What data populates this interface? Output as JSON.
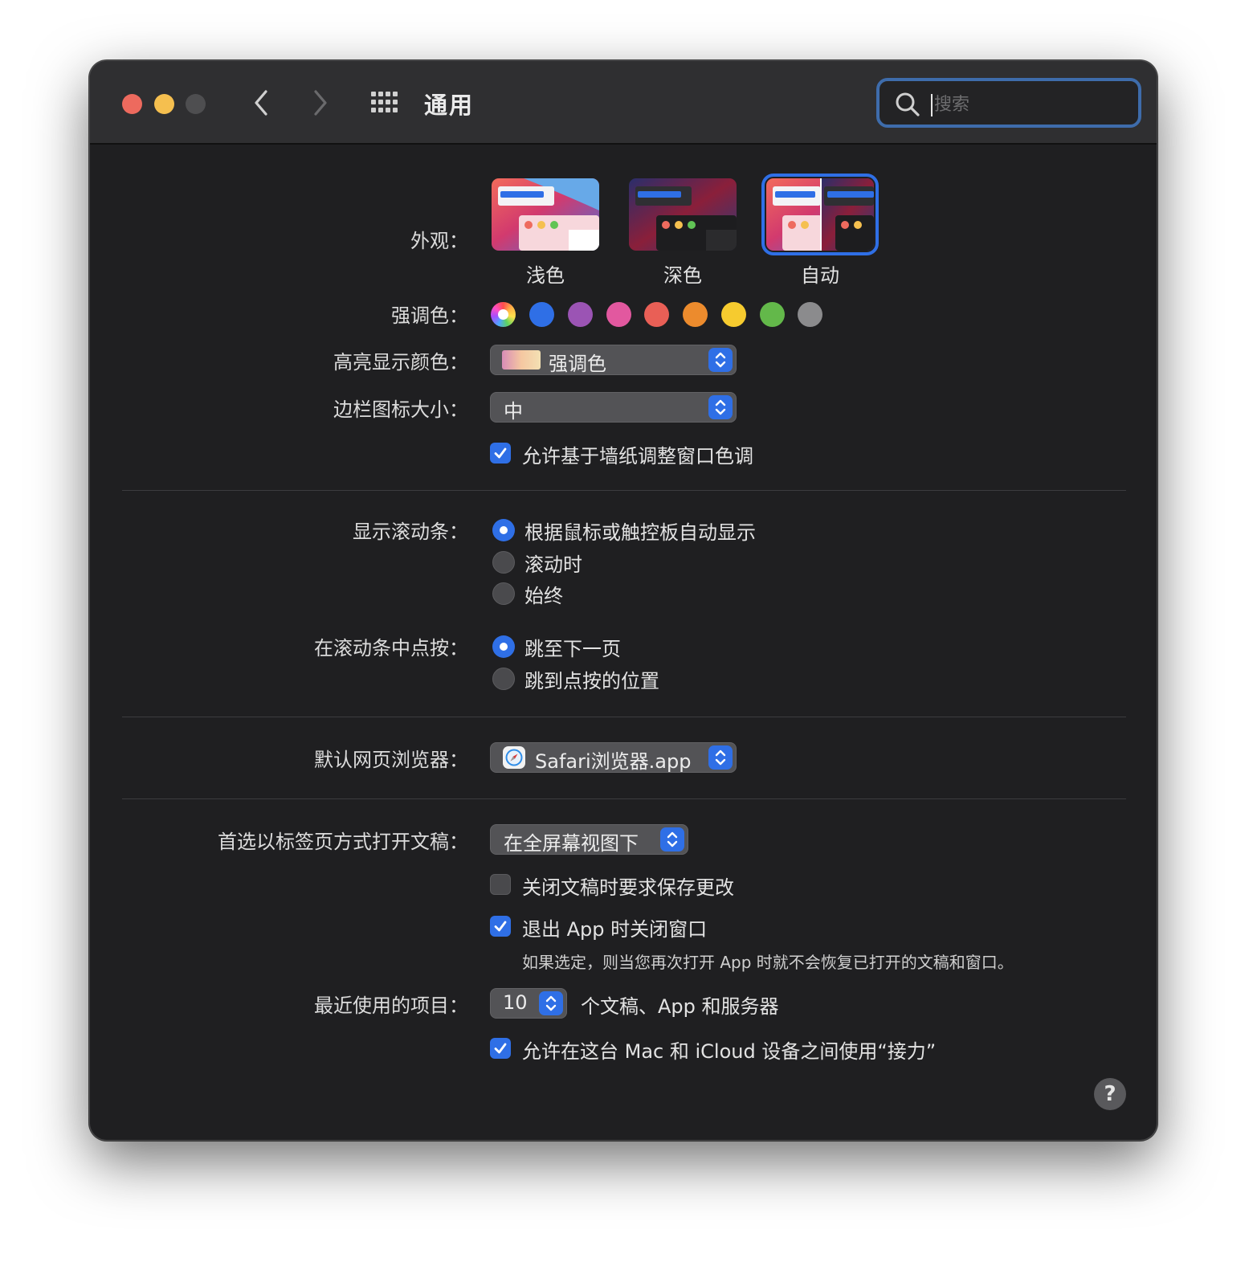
{
  "window": {
    "title": "通用",
    "search_placeholder": "搜索"
  },
  "appearance": {
    "label": "外观：",
    "options": [
      "浅色",
      "深色",
      "自动"
    ],
    "selected": "自动"
  },
  "accent": {
    "label": "强调色：",
    "colors": [
      "multicolor",
      "#2f6fe6",
      "#9b54b4",
      "#e2589f",
      "#e95f56",
      "#ec8b2d",
      "#f6cb2f",
      "#63b84a",
      "#8b8b8d"
    ]
  },
  "highlight": {
    "label": "高亮显示颜色：",
    "value": "强调色"
  },
  "sidebar_icon": {
    "label": "边栏图标大小：",
    "value": "中"
  },
  "wallpaper_tint": {
    "label": "允许基于墙纸调整窗口色调",
    "checked": true
  },
  "scrollbars": {
    "label": "显示滚动条：",
    "options": [
      "根据鼠标或触控板自动显示",
      "滚动时",
      "始终"
    ],
    "selected": 0
  },
  "click_scrollbar": {
    "label": "在滚动条中点按：",
    "options": [
      "跳至下一页",
      "跳到点按的位置"
    ],
    "selected": 0
  },
  "browser": {
    "label": "默认网页浏览器：",
    "value": "Safari浏览器.app"
  },
  "tabs_pref": {
    "label": "首选以标签页方式打开文稿：",
    "value": "在全屏幕视图下"
  },
  "ask_save": {
    "label": "关闭文稿时要求保存更改",
    "checked": false
  },
  "close_windows": {
    "label": "退出 App 时关闭窗口",
    "checked": true,
    "note": "如果选定，则当您再次打开 App 时就不会恢复已打开的文稿和窗口。"
  },
  "recent_items": {
    "label": "最近使用的项目：",
    "value": "10",
    "suffix": "个文稿、App 和服务器"
  },
  "handoff": {
    "label": "允许在这台 Mac 和 iCloud 设备之间使用“接力”",
    "checked": true
  },
  "help": "?"
}
